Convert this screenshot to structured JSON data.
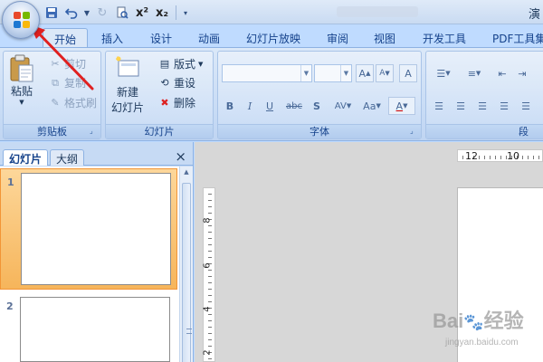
{
  "titlebar": {
    "app_title": "演",
    "qat": {
      "undo_icon": "undo-icon",
      "superscript": "x²",
      "subscript": "x₂"
    }
  },
  "tabs": [
    "开始",
    "插入",
    "设计",
    "动画",
    "幻灯片放映",
    "审阅",
    "视图",
    "开发工具",
    "PDF工具集"
  ],
  "active_tab": "开始",
  "ribbon": {
    "clipboard": {
      "label": "剪贴板",
      "paste": "粘贴",
      "cut": "剪切",
      "copy": "复制",
      "format_painter": "格式刷"
    },
    "slides": {
      "label": "幻灯片",
      "new_slide_line1": "新建",
      "new_slide_line2": "幻灯片",
      "layout": "版式",
      "reset": "重设",
      "delete": "删除"
    },
    "font": {
      "label": "字体",
      "bold": "B",
      "italic": "I",
      "underline": "U",
      "strikethrough": "abc",
      "shadow": "S",
      "spacing": "AV",
      "case": "Aa",
      "color": "A",
      "grow": "A",
      "shrink": "A",
      "clear": "A"
    },
    "paragraph": {
      "label": "段"
    }
  },
  "left_pane": {
    "tab_slides": "幻灯片",
    "tab_outline": "大纲",
    "close": "×",
    "slides": [
      {
        "number": "1",
        "selected": true
      },
      {
        "number": "2",
        "selected": false
      }
    ]
  },
  "ruler": {
    "h_labels": [
      "12",
      "10"
    ],
    "v_labels": [
      "8",
      "6",
      "4",
      "2"
    ]
  },
  "watermark": {
    "brand": "Bai",
    "suffix": "经验",
    "url": "jingyan.baidu.com"
  },
  "colors": {
    "ribbon_bg": "#dbe8f8",
    "selected_thumb": "#f6b55b",
    "annotation_arrow": "#e02020"
  }
}
